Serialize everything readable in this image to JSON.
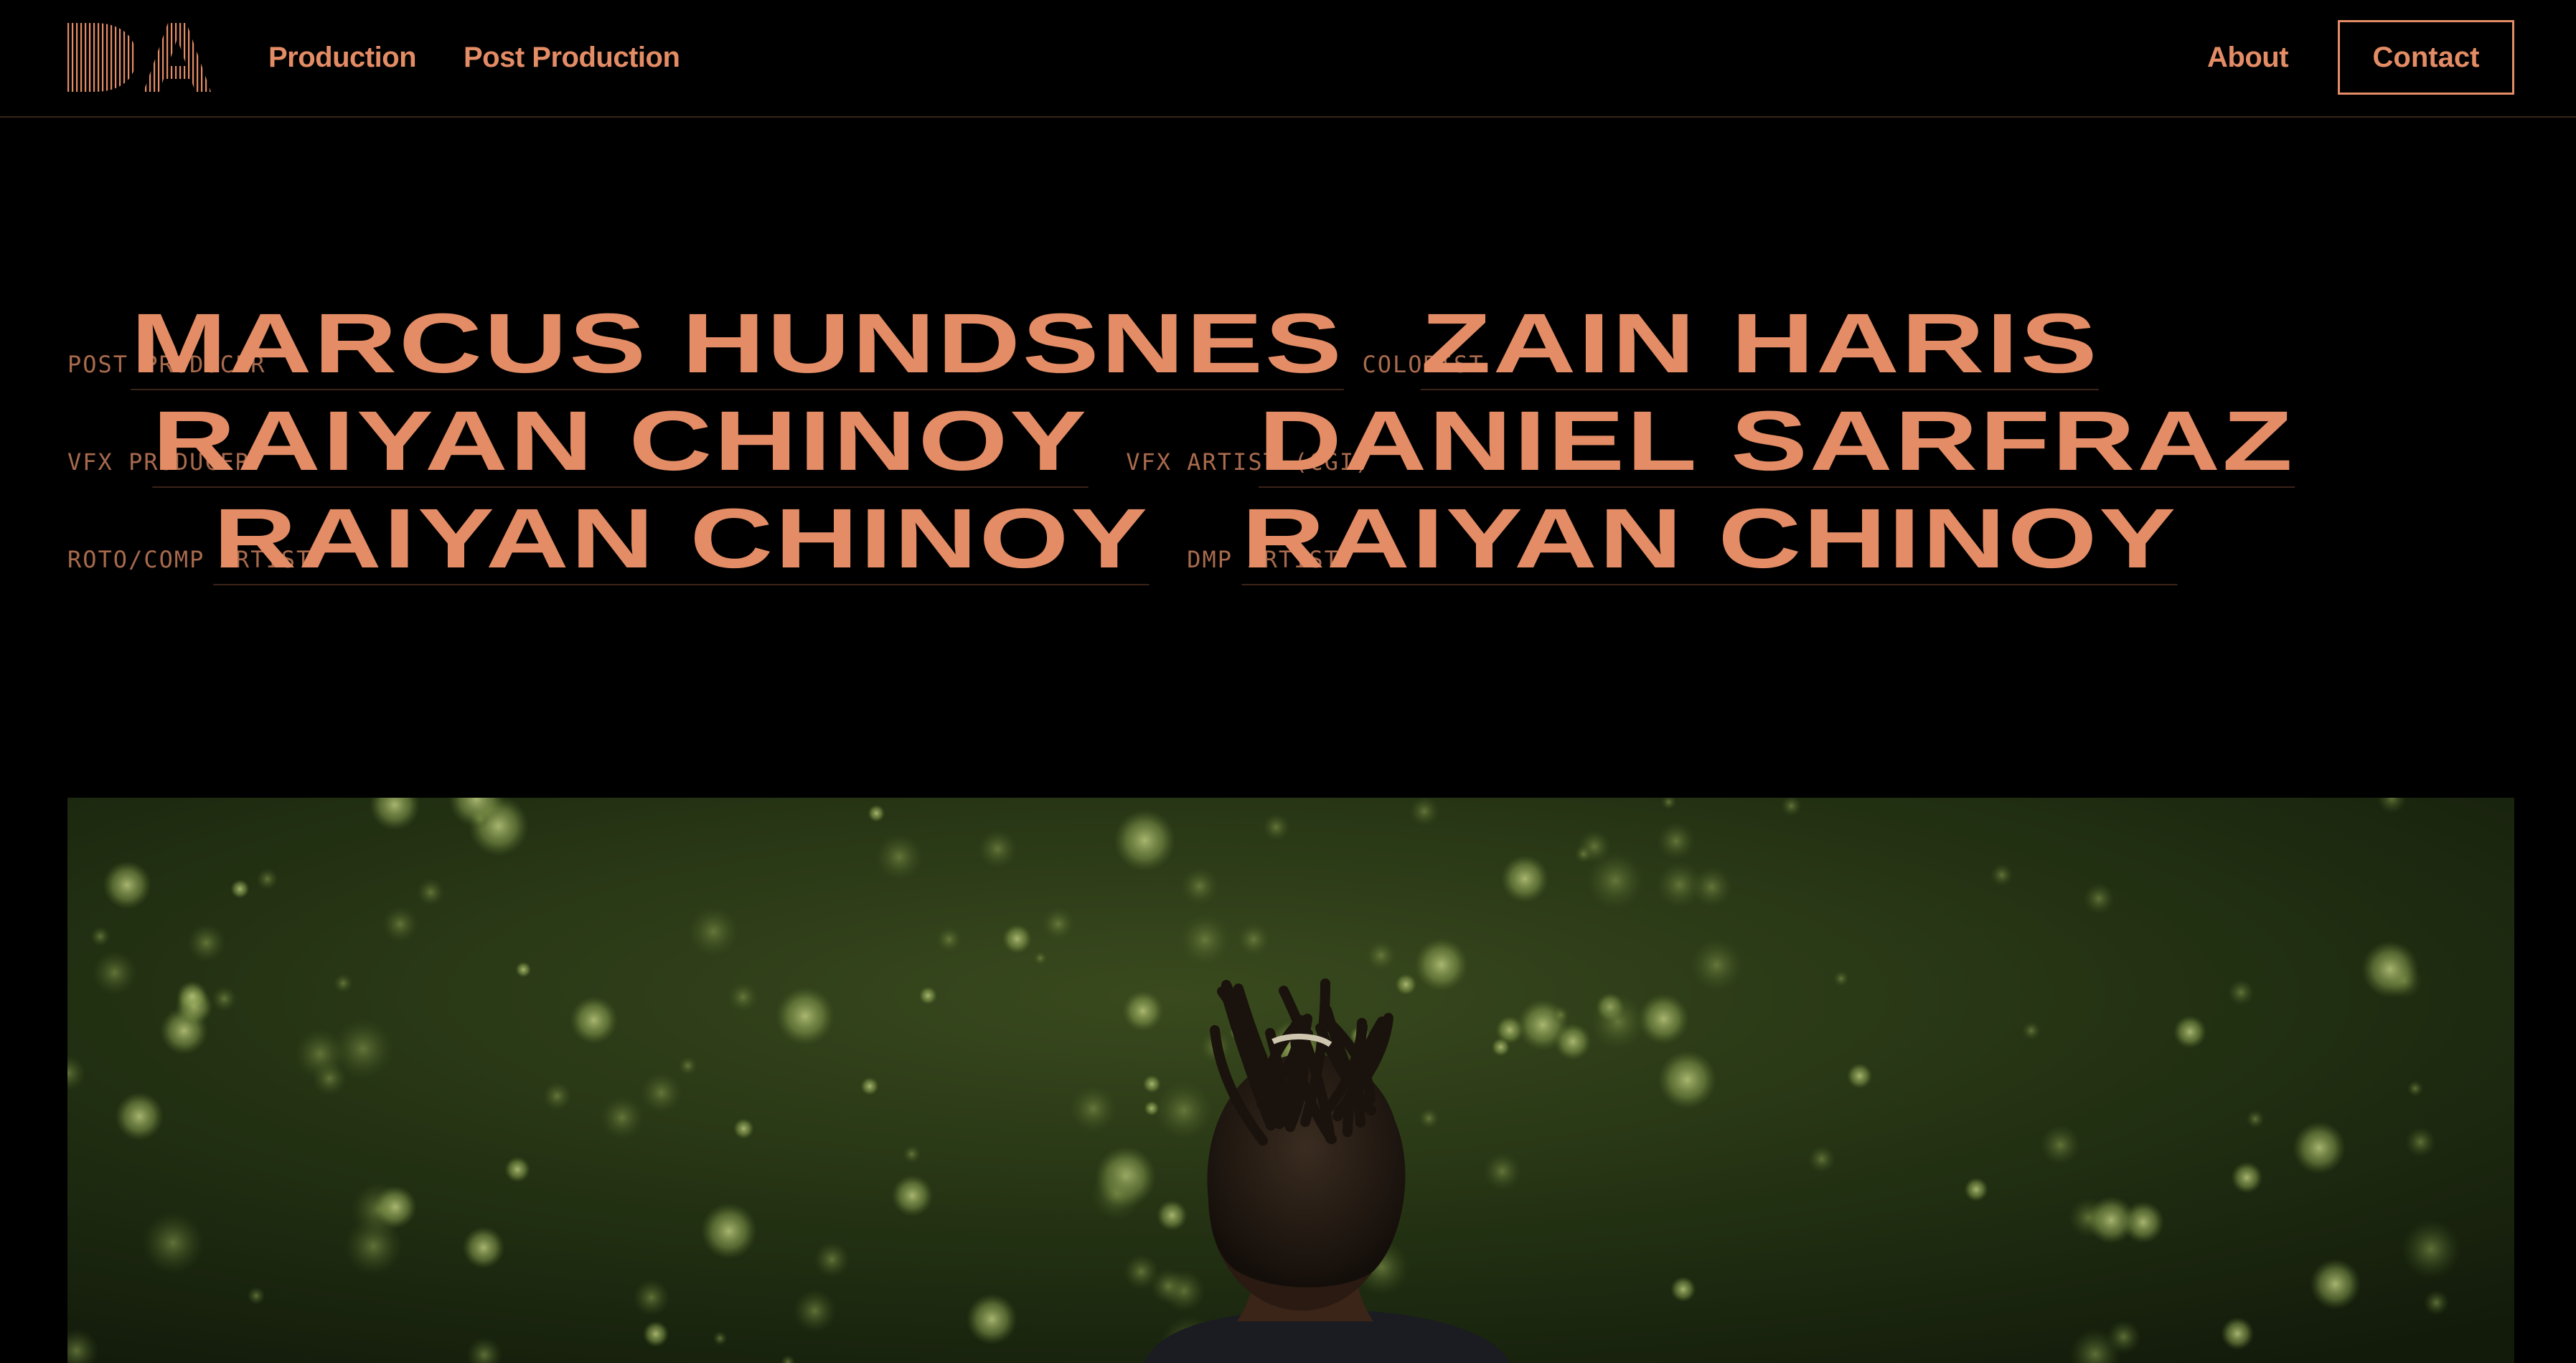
{
  "header": {
    "logo_alt": "DA",
    "nav": {
      "production": "Production",
      "post_production": "Post Production",
      "about": "About"
    },
    "contact_label": "Contact"
  },
  "credits": [
    [
      {
        "role": "POST PRODUCER",
        "name": "MARCUS HUNDSNES"
      },
      {
        "role": "COLORIST",
        "name": "ZAIN HARIS"
      }
    ],
    [
      {
        "role": "VFX PRODUCER",
        "name": "RAIYAN CHINOY"
      },
      {
        "role": "VFX ARTIST (CGI)",
        "name": "DANIEL SARFRAZ"
      }
    ],
    [
      {
        "role": "ROTO/COMP ARTIST",
        "name": "RAIYAN CHINOY"
      },
      {
        "role": "DMP ARTIST",
        "name": "RAIYAN CHINOY"
      }
    ]
  ],
  "colors": {
    "accent": "#e38c65",
    "role_text": "#a86a4d",
    "background": "#000000"
  },
  "hero": {
    "icon": "photo-person-in-forest"
  }
}
